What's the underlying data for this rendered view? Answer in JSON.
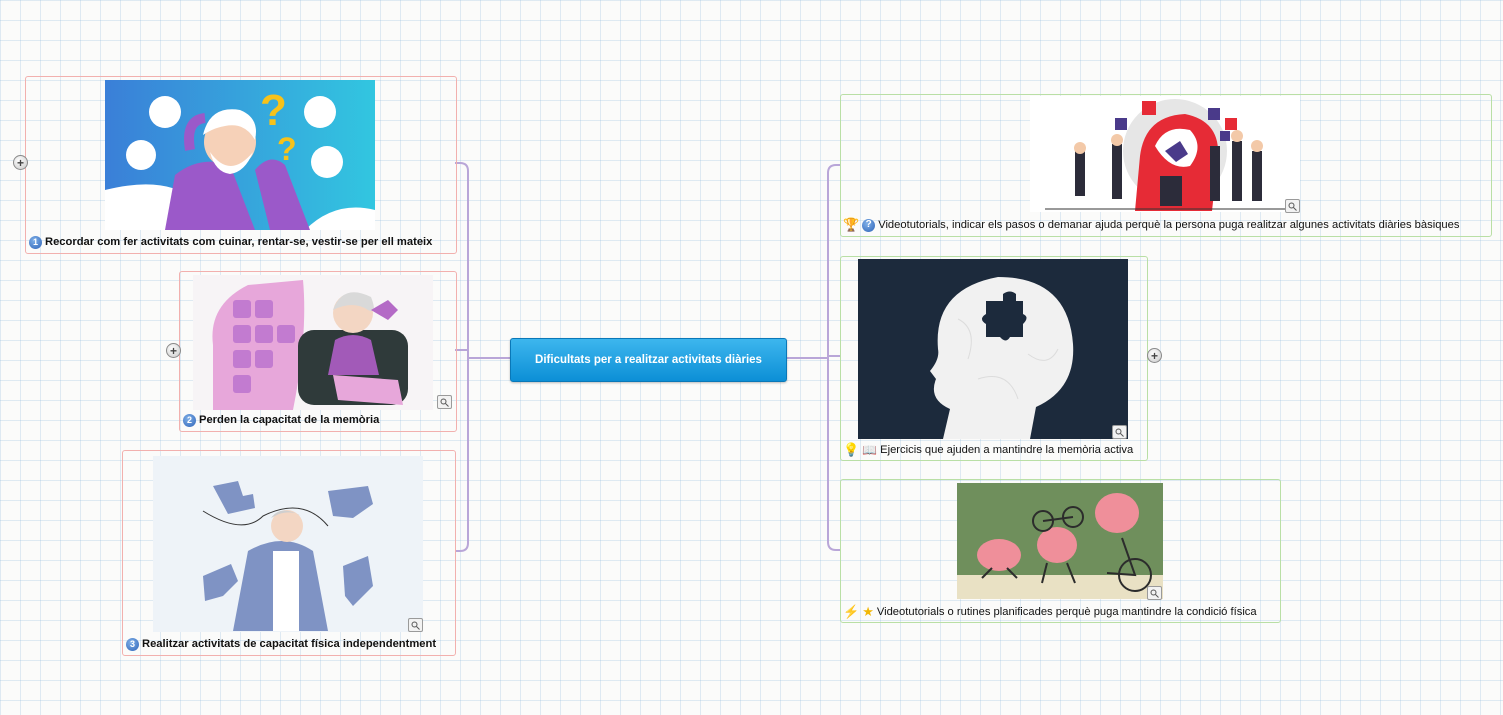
{
  "central": {
    "title": "Dificultats per a realitzar activitats diàries"
  },
  "left_nodes": [
    {
      "number": "1",
      "label": "Recordar com fer activitats com cuinar, rentar-se, vestir-se per ell mateix",
      "image": "elderly-man-confused-illustration"
    },
    {
      "number": "2",
      "label": "Perden la capacitat de la memòria",
      "image": "elderly-woman-puzzle-head-illustration"
    },
    {
      "number": "3",
      "label": "Realitzar activitats de capacitat física independentment",
      "image": "elderly-man-puzzle-pieces-illustration"
    }
  ],
  "right_nodes": [
    {
      "icons": [
        "trophy-icon",
        "question-icon"
      ],
      "label": "Videotutorials, indicar els pasos o demanar ajuda perquè la persona puga realitzar algunes activitats diàries bàsiques",
      "image": "brain-puzzle-people-illustration"
    },
    {
      "icons": [
        "lightbulb-icon",
        "book-icon"
      ],
      "label": "Ejercicis que ajuden a mantindre la memòria activa",
      "image": "head-silhouette-puzzle-illustration"
    },
    {
      "icons": [
        "lightning-icon",
        "star-icon"
      ],
      "label": "Videotutorials o rutines planificades perquè puga mantindre la condició física",
      "image": "brains-exercising-illustration"
    }
  ],
  "colors": {
    "left_border": "#f2b0ae",
    "right_border": "#b9dfa5",
    "connector": "#b9a6d8",
    "central_bg": "#1aa0e2"
  }
}
